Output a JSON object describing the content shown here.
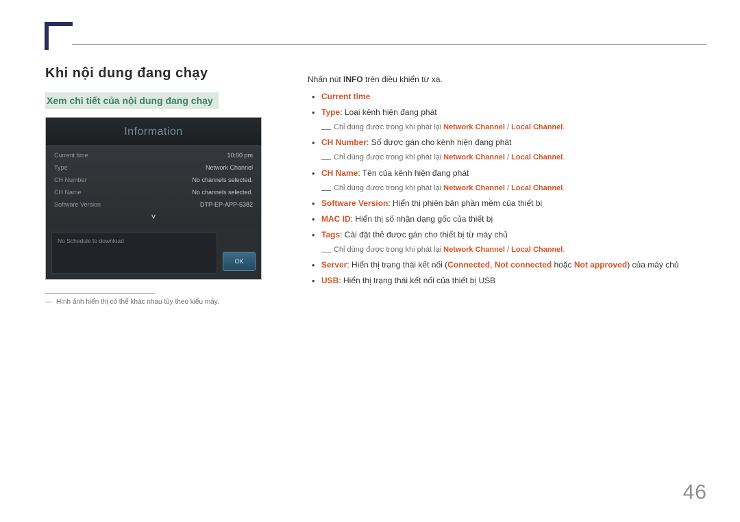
{
  "headings": {
    "title": "Khi nội dung đang chạy",
    "subtitle": "Xem chi tiết của nội dung đang chạy"
  },
  "info_panel": {
    "title": "Information",
    "rows": [
      {
        "k": "Current time",
        "v": "10:00 pm"
      },
      {
        "k": "Type",
        "v": "Network Channel"
      },
      {
        "k": "CH Number",
        "v": "No channels selected."
      },
      {
        "k": "CH Name",
        "v": "No channels selected."
      },
      {
        "k": "Software Version",
        "v": "DTP-EP-APP-5382"
      }
    ],
    "schedule_empty": "No Schedule to download",
    "ok_label": "OK"
  },
  "footnote": "Hình ảnh hiển thị có thể khác nhau tùy theo kiểu máy.",
  "intro": {
    "prefix": "Nhấn nút ",
    "bold": "INFO",
    "suffix": " trên điều khiển từ xa."
  },
  "sub_only_when": "Chỉ dùng được trong khi phát lại ",
  "sub_net": "Network Channel",
  "sub_sep": " / ",
  "sub_loc": "Local Channel",
  "sub_period": ".",
  "items": {
    "current_time": "Current time",
    "type_label": "Type",
    "type_text": ": Loại kênh hiện đang phát",
    "ch_number_label": "CH Number",
    "ch_number_text": ": Số được gán cho kênh hiện đang phát",
    "ch_name_label": "CH Name",
    "ch_name_text": ": Tên của kênh hiện đang phát",
    "sw_label": "Software Version",
    "sw_text": ": Hiển thị phiên bản phần mềm của thiết bị",
    "mac_label": "MAC ID",
    "mac_text": ": Hiển thị số nhận dạng gốc của thiết bị",
    "tags_label": "Tags",
    "tags_text": ": Cài đặt thẻ được gán cho thiết bị từ máy chủ",
    "server_label": "Server",
    "server_text1": ": Hiển thị trạng thái kết nối (",
    "server_connected": "Connected",
    "server_comma": ", ",
    "server_not_connected": "Not connected",
    "server_or": " hoặc ",
    "server_not_approved": "Not approved",
    "server_text2": ") của máy chủ",
    "usb_label": "USB",
    "usb_text": ": Hiển thị trạng thái kết nối của thiết bị USB"
  },
  "page_number": "46"
}
